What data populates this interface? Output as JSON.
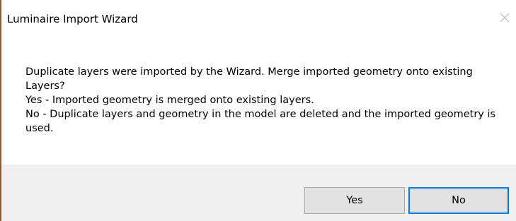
{
  "window": {
    "title": "Luminaire Import Wizard",
    "close_icon": "close-icon"
  },
  "message": {
    "lines": [
      "Duplicate layers were imported by the Wizard.  Merge imported geometry onto existing Layers?",
      "Yes - Imported geometry is merged onto existing layers.",
      "No - Duplicate layers and geometry in the model are deleted and the imported geometry is used."
    ]
  },
  "buttons": {
    "yes_label": "Yes",
    "no_label": "No"
  },
  "colors": {
    "footer_bg": "#f0f0f0",
    "default_button_border": "#0078d7",
    "button_bg": "#e1e1e1",
    "window_border": "#a0522d"
  }
}
